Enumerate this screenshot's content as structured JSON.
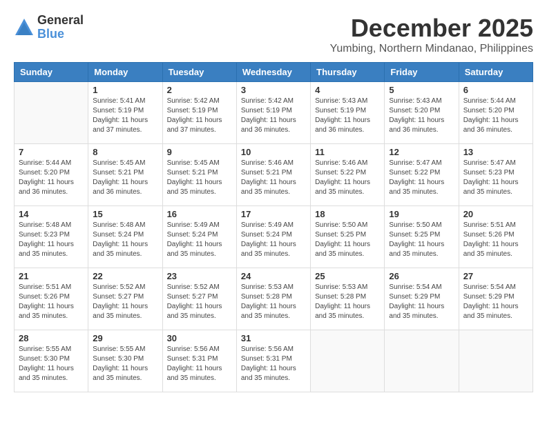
{
  "logo": {
    "general": "General",
    "blue": "Blue"
  },
  "title": {
    "month": "December 2025",
    "location": "Yumbing, Northern Mindanao, Philippines"
  },
  "headers": [
    "Sunday",
    "Monday",
    "Tuesday",
    "Wednesday",
    "Thursday",
    "Friday",
    "Saturday"
  ],
  "weeks": [
    [
      {
        "day": "",
        "info": ""
      },
      {
        "day": "1",
        "info": "Sunrise: 5:41 AM\nSunset: 5:19 PM\nDaylight: 11 hours\nand 37 minutes."
      },
      {
        "day": "2",
        "info": "Sunrise: 5:42 AM\nSunset: 5:19 PM\nDaylight: 11 hours\nand 37 minutes."
      },
      {
        "day": "3",
        "info": "Sunrise: 5:42 AM\nSunset: 5:19 PM\nDaylight: 11 hours\nand 36 minutes."
      },
      {
        "day": "4",
        "info": "Sunrise: 5:43 AM\nSunset: 5:19 PM\nDaylight: 11 hours\nand 36 minutes."
      },
      {
        "day": "5",
        "info": "Sunrise: 5:43 AM\nSunset: 5:20 PM\nDaylight: 11 hours\nand 36 minutes."
      },
      {
        "day": "6",
        "info": "Sunrise: 5:44 AM\nSunset: 5:20 PM\nDaylight: 11 hours\nand 36 minutes."
      }
    ],
    [
      {
        "day": "7",
        "info": "Sunrise: 5:44 AM\nSunset: 5:20 PM\nDaylight: 11 hours\nand 36 minutes."
      },
      {
        "day": "8",
        "info": "Sunrise: 5:45 AM\nSunset: 5:21 PM\nDaylight: 11 hours\nand 36 minutes."
      },
      {
        "day": "9",
        "info": "Sunrise: 5:45 AM\nSunset: 5:21 PM\nDaylight: 11 hours\nand 35 minutes."
      },
      {
        "day": "10",
        "info": "Sunrise: 5:46 AM\nSunset: 5:21 PM\nDaylight: 11 hours\nand 35 minutes."
      },
      {
        "day": "11",
        "info": "Sunrise: 5:46 AM\nSunset: 5:22 PM\nDaylight: 11 hours\nand 35 minutes."
      },
      {
        "day": "12",
        "info": "Sunrise: 5:47 AM\nSunset: 5:22 PM\nDaylight: 11 hours\nand 35 minutes."
      },
      {
        "day": "13",
        "info": "Sunrise: 5:47 AM\nSunset: 5:23 PM\nDaylight: 11 hours\nand 35 minutes."
      }
    ],
    [
      {
        "day": "14",
        "info": "Sunrise: 5:48 AM\nSunset: 5:23 PM\nDaylight: 11 hours\nand 35 minutes."
      },
      {
        "day": "15",
        "info": "Sunrise: 5:48 AM\nSunset: 5:24 PM\nDaylight: 11 hours\nand 35 minutes."
      },
      {
        "day": "16",
        "info": "Sunrise: 5:49 AM\nSunset: 5:24 PM\nDaylight: 11 hours\nand 35 minutes."
      },
      {
        "day": "17",
        "info": "Sunrise: 5:49 AM\nSunset: 5:24 PM\nDaylight: 11 hours\nand 35 minutes."
      },
      {
        "day": "18",
        "info": "Sunrise: 5:50 AM\nSunset: 5:25 PM\nDaylight: 11 hours\nand 35 minutes."
      },
      {
        "day": "19",
        "info": "Sunrise: 5:50 AM\nSunset: 5:25 PM\nDaylight: 11 hours\nand 35 minutes."
      },
      {
        "day": "20",
        "info": "Sunrise: 5:51 AM\nSunset: 5:26 PM\nDaylight: 11 hours\nand 35 minutes."
      }
    ],
    [
      {
        "day": "21",
        "info": "Sunrise: 5:51 AM\nSunset: 5:26 PM\nDaylight: 11 hours\nand 35 minutes."
      },
      {
        "day": "22",
        "info": "Sunrise: 5:52 AM\nSunset: 5:27 PM\nDaylight: 11 hours\nand 35 minutes."
      },
      {
        "day": "23",
        "info": "Sunrise: 5:52 AM\nSunset: 5:27 PM\nDaylight: 11 hours\nand 35 minutes."
      },
      {
        "day": "24",
        "info": "Sunrise: 5:53 AM\nSunset: 5:28 PM\nDaylight: 11 hours\nand 35 minutes."
      },
      {
        "day": "25",
        "info": "Sunrise: 5:53 AM\nSunset: 5:28 PM\nDaylight: 11 hours\nand 35 minutes."
      },
      {
        "day": "26",
        "info": "Sunrise: 5:54 AM\nSunset: 5:29 PM\nDaylight: 11 hours\nand 35 minutes."
      },
      {
        "day": "27",
        "info": "Sunrise: 5:54 AM\nSunset: 5:29 PM\nDaylight: 11 hours\nand 35 minutes."
      }
    ],
    [
      {
        "day": "28",
        "info": "Sunrise: 5:55 AM\nSunset: 5:30 PM\nDaylight: 11 hours\nand 35 minutes."
      },
      {
        "day": "29",
        "info": "Sunrise: 5:55 AM\nSunset: 5:30 PM\nDaylight: 11 hours\nand 35 minutes."
      },
      {
        "day": "30",
        "info": "Sunrise: 5:56 AM\nSunset: 5:31 PM\nDaylight: 11 hours\nand 35 minutes."
      },
      {
        "day": "31",
        "info": "Sunrise: 5:56 AM\nSunset: 5:31 PM\nDaylight: 11 hours\nand 35 minutes."
      },
      {
        "day": "",
        "info": ""
      },
      {
        "day": "",
        "info": ""
      },
      {
        "day": "",
        "info": ""
      }
    ]
  ]
}
